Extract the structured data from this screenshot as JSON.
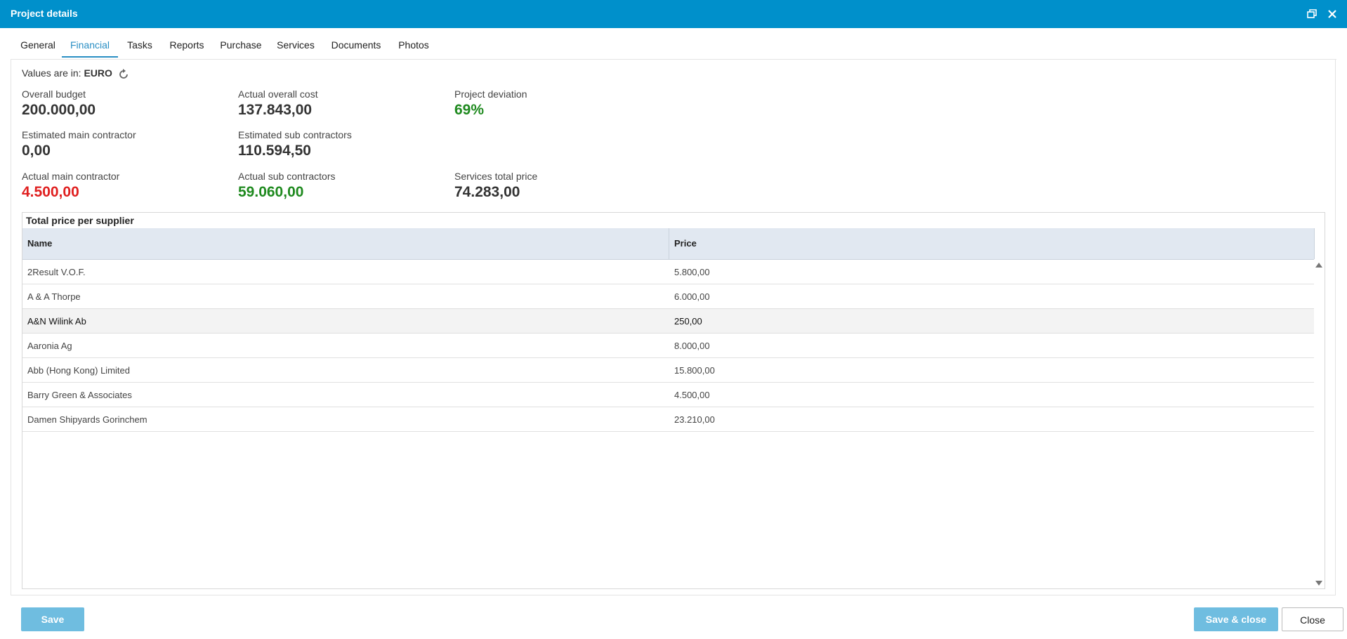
{
  "window": {
    "title": "Project details"
  },
  "tabs": [
    {
      "label": "General"
    },
    {
      "label": "Financial"
    },
    {
      "label": "Tasks"
    },
    {
      "label": "Reports"
    },
    {
      "label": "Purchase"
    },
    {
      "label": "Services"
    },
    {
      "label": "Documents"
    },
    {
      "label": "Photos"
    }
  ],
  "currency": {
    "prefix": "Values are in:",
    "value": "EURO"
  },
  "stats": {
    "overall_budget": {
      "label": "Overall budget",
      "value": "200.000,00"
    },
    "actual_overall_cost": {
      "label": "Actual overall cost",
      "value": "137.843,00"
    },
    "project_deviation": {
      "label": "Project deviation",
      "value": "69%"
    },
    "estimated_main_contractor": {
      "label": "Estimated main contractor",
      "value": "0,00"
    },
    "estimated_sub_contractors": {
      "label": "Estimated sub contractors",
      "value": "110.594,50"
    },
    "actual_main_contractor": {
      "label": "Actual main contractor",
      "value": "4.500,00"
    },
    "actual_sub_contractors": {
      "label": "Actual sub contractors",
      "value": "59.060,00"
    },
    "services_total_price": {
      "label": "Services total price",
      "value": "74.283,00"
    }
  },
  "colors": {
    "header": "#0090cb",
    "accent": "#2a8fc4",
    "positive": "#1f8a1f",
    "negative": "#e02020"
  },
  "supplier_table": {
    "title": "Total price per supplier",
    "columns": [
      "Name",
      "Price"
    ],
    "rows": [
      {
        "name": "2Result V.O.F.",
        "price": "5.800,00"
      },
      {
        "name": "A & A Thorpe",
        "price": "6.000,00"
      },
      {
        "name": "A&N Wilink Ab",
        "price": "250,00"
      },
      {
        "name": "Aaronia Ag",
        "price": "8.000,00"
      },
      {
        "name": "Abb (Hong Kong) Limited",
        "price": "15.800,00"
      },
      {
        "name": "Barry Green & Associates",
        "price": "4.500,00"
      },
      {
        "name": "Damen Shipyards Gorinchem",
        "price": "23.210,00"
      }
    ]
  },
  "footer": {
    "save": "Save",
    "save_close": "Save & close",
    "close": "Close"
  }
}
